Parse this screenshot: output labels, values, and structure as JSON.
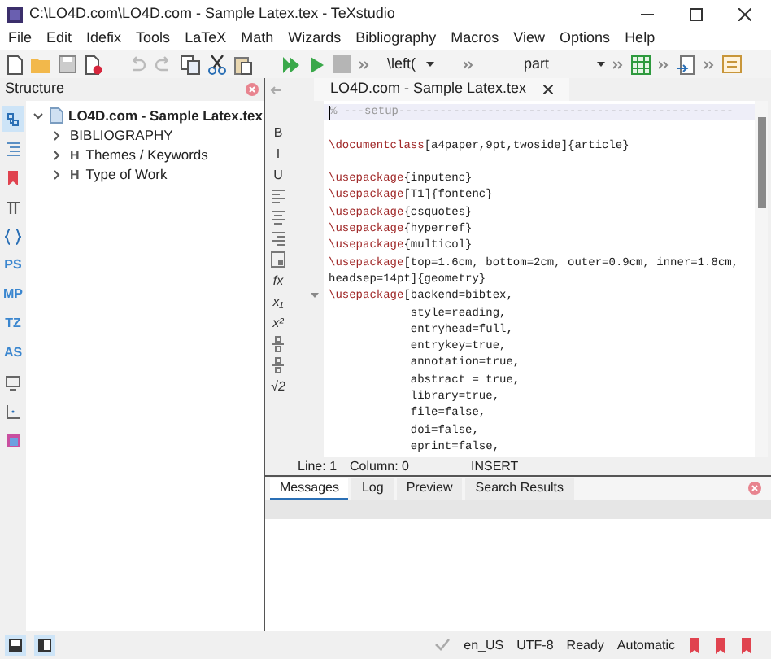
{
  "window": {
    "title": "C:\\LO4D.com\\LO4D.com - Sample Latex.tex - TeXstudio"
  },
  "menu": [
    "File",
    "Edit",
    "Idefix",
    "Tools",
    "LaTeX",
    "Math",
    "Wizards",
    "Bibliography",
    "Macros",
    "View",
    "Options",
    "Help"
  ],
  "toolbar": {
    "command_field": "\\left(",
    "structure_field": "part"
  },
  "structure": {
    "title": "Structure",
    "side_tabs": [
      {
        "kind": "tree",
        "selected": true
      },
      {
        "kind": "toc",
        "selected": false
      },
      {
        "kind": "bookmark",
        "selected": false
      },
      {
        "kind": "pi",
        "selected": false
      },
      {
        "kind": "braces",
        "selected": false
      },
      {
        "kind": "text",
        "label": "PS",
        "selected": false
      },
      {
        "kind": "text",
        "label": "MP",
        "selected": false
      },
      {
        "kind": "text",
        "label": "TZ",
        "selected": false
      },
      {
        "kind": "text",
        "label": "AS",
        "selected": false
      },
      {
        "kind": "screen",
        "selected": false
      },
      {
        "kind": "axes",
        "selected": false
      },
      {
        "kind": "image",
        "selected": false
      }
    ],
    "tree": {
      "label": "LO4D.com - Sample Latex.tex",
      "expanded": true,
      "children": [
        {
          "label": "BIBLIOGRAPHY",
          "expanded": false
        },
        {
          "label": "Themes / Keywords",
          "marker": "H",
          "expanded": false
        },
        {
          "label": "Type of Work",
          "marker": "H",
          "expanded": false
        }
      ]
    }
  },
  "editor": {
    "tab": {
      "label": "LO4D.com - Sample Latex.tex"
    },
    "format_tools": [
      {
        "kind": "text",
        "label": "B"
      },
      {
        "kind": "text",
        "label": "I"
      },
      {
        "kind": "text",
        "label": "U"
      },
      {
        "kind": "align-left"
      },
      {
        "kind": "align-center"
      },
      {
        "kind": "align-right"
      },
      {
        "kind": "frame"
      },
      {
        "kind": "text",
        "label": "fx"
      },
      {
        "kind": "text",
        "label": "x₁"
      },
      {
        "kind": "text",
        "label": "x²"
      },
      {
        "kind": "fraction"
      },
      {
        "kind": "fraction"
      },
      {
        "kind": "text",
        "label": "√2"
      }
    ],
    "lines": [
      {
        "kind": "comment",
        "text": "% ---setup-------------------------------------------------",
        "current": true,
        "fold": false
      },
      {
        "kind": "blank",
        "current": false,
        "fold": false
      },
      {
        "kind": "code",
        "cmd": "\\documentclass",
        "text": "[a4paper,9pt,twoside]{article}",
        "current": false,
        "fold": false
      },
      {
        "kind": "blank",
        "current": false,
        "fold": false
      },
      {
        "kind": "code",
        "cmd": "\\usepackage",
        "text": "{inputenc}",
        "current": false,
        "fold": false
      },
      {
        "kind": "code",
        "cmd": "\\usepackage",
        "text": "[T1]{fontenc}",
        "current": false,
        "fold": false
      },
      {
        "kind": "code",
        "cmd": "\\usepackage",
        "text": "{csquotes}",
        "current": false,
        "fold": false
      },
      {
        "kind": "code",
        "cmd": "\\usepackage",
        "text": "{hyperref}",
        "current": false,
        "fold": false
      },
      {
        "kind": "code",
        "cmd": "\\usepackage",
        "text": "{multicol}",
        "current": false,
        "fold": false
      },
      {
        "kind": "code",
        "cmd": "\\usepackage",
        "text": "[top=1.6cm, bottom=2cm, outer=0.9cm, inner=1.8cm,",
        "current": false,
        "fold": false
      },
      {
        "kind": "code",
        "text": "headsep=14pt]{geometry}",
        "current": false,
        "fold": false
      },
      {
        "kind": "code",
        "cmd": "\\usepackage",
        "text": "[backend=bibtex,",
        "current": false,
        "fold": true
      },
      {
        "kind": "code",
        "text": "            style=reading,",
        "current": false,
        "fold": false
      },
      {
        "kind": "code",
        "text": "            entryhead=full,",
        "current": false,
        "fold": false
      },
      {
        "kind": "code",
        "text": "            entrykey=true,",
        "current": false,
        "fold": false
      },
      {
        "kind": "code",
        "text": "            annotation=true,",
        "current": false,
        "fold": false
      },
      {
        "kind": "code",
        "text": "            abstract = true,",
        "current": false,
        "fold": false
      },
      {
        "kind": "code",
        "text": "            library=true,",
        "current": false,
        "fold": false
      },
      {
        "kind": "code",
        "text": "            file=false,",
        "current": false,
        "fold": false
      },
      {
        "kind": "code",
        "text": "            doi=false,",
        "current": false,
        "fold": false
      },
      {
        "kind": "code",
        "text": "            eprint=false,",
        "current": false,
        "fold": false
      }
    ],
    "status": {
      "line": "Line: 1",
      "column": "Column: 0",
      "mode": "INSERT"
    }
  },
  "messages": {
    "tabs": [
      {
        "label": "Messages",
        "selected": true
      },
      {
        "label": "Log",
        "selected": false
      },
      {
        "label": "Preview",
        "selected": false
      },
      {
        "label": "Search Results",
        "selected": false
      }
    ]
  },
  "status_bar": {
    "items": [
      "en_US",
      "UTF-8",
      "Ready",
      "Automatic"
    ]
  }
}
